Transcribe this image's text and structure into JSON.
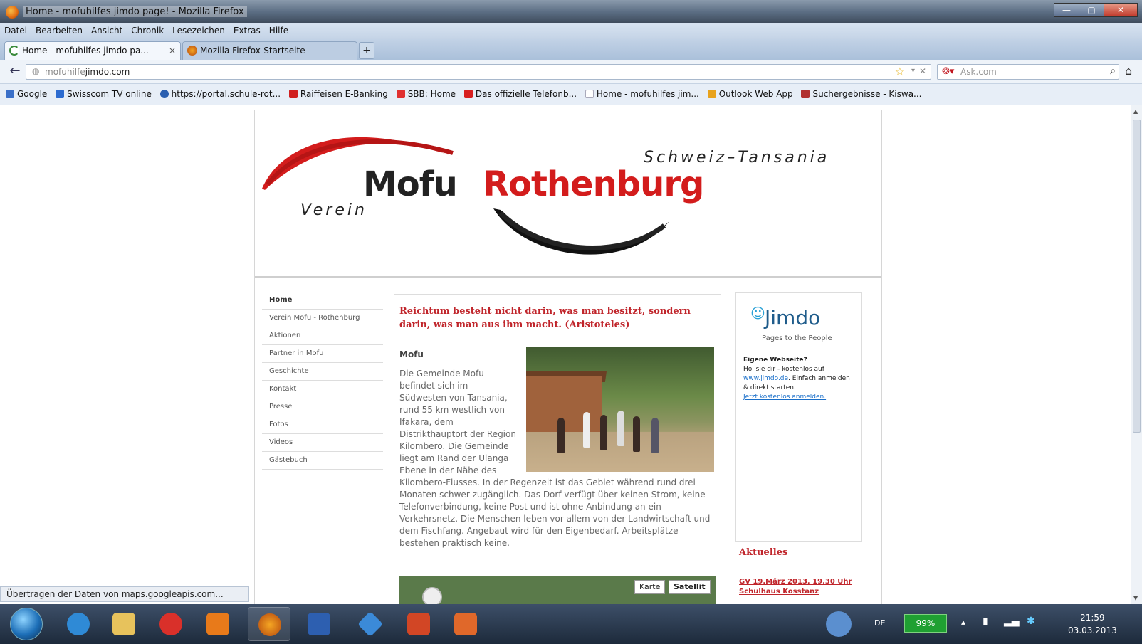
{
  "window": {
    "title": "Home - mofuhilfes jimdo page! - Mozilla Firefox",
    "controls": {
      "minimize": "—",
      "maximize": "▢",
      "close": "✕"
    }
  },
  "menu": [
    "Datei",
    "Bearbeiten",
    "Ansicht",
    "Chronik",
    "Lesezeichen",
    "Extras",
    "Hilfe"
  ],
  "tabs": [
    {
      "label": "Home - mofuhilfes jimdo pa...",
      "close": "×"
    },
    {
      "label": "Mozilla Firefox-Startseite"
    }
  ],
  "new_tab": "+",
  "nav": {
    "back": "←",
    "url_grey": "mofuhilfe",
    "url_main": "jimdo.com",
    "search_engine": "Ask",
    "search_placeholder": "Ask.com",
    "home": "⌂"
  },
  "bookmarks": [
    {
      "label": "Google",
      "color": "#3a6fc8"
    },
    {
      "label": "Swisscom TV online",
      "color": "#2c6bd0"
    },
    {
      "label": "https://portal.schule-rot...",
      "color": "#2a5fb0"
    },
    {
      "label": "Raiffeisen E-Banking",
      "color": "#d01f1f"
    },
    {
      "label": "SBB: Home",
      "color": "#e03030"
    },
    {
      "label": "Das offizielle Telefonb...",
      "color": "#d81f1f"
    },
    {
      "label": "Home - mofuhilfes jim...",
      "color": "#c9d3df"
    },
    {
      "label": "Outlook Web App",
      "color": "#e8a21c"
    },
    {
      "label": "Suchergebnisse - Kiswa...",
      "color": "#b03030"
    }
  ],
  "site": {
    "logo": {
      "verein": "Verein",
      "mofu": "Mofu",
      "rothenburg": "Rothenburg",
      "schweiz": "Schweiz–Tansania"
    },
    "nav_items": [
      "Home",
      "Verein Mofu - Rothenburg",
      "Aktionen",
      "Partner in Mofu",
      "Geschichte",
      "Kontakt",
      "Presse",
      "Fotos",
      "Videos",
      "Gästebuch"
    ],
    "quote": "Reichtum besteht nicht darin, was man besitzt, sondern darin, was man aus ihm macht. (Aristoteles)",
    "section_heading": "Mofu",
    "body_narrow": "Die Gemeinde Mofu befindet sich im Südwesten von Tansania, rund 55 km westlich von Ifakara, dem Distrikthauptort der Region Kilombero. Die Gemeinde liegt am Rand der Ulanga Ebene in der Nähe des",
    "body_wide": "Kilombero-Flusses. In der Regenzeit ist das Gebiet während rund drei Monaten schwer zugänglich. Das Dorf verfügt über keinen Strom, keine Telefonverbindung, keine Post und ist ohne Anbindung an ein Verkehrsnetz. Die Menschen leben vor allem von der Landwirtschaft und dem Fischfang. Angebaut wird für den Eigenbedarf. Arbeitsplätze bestehen praktisch keine.",
    "map_buttons": {
      "karte": "Karte",
      "satellit": "Satellit"
    },
    "sidebar": {
      "jimdo": "Jimdo",
      "jimdo_tagline": "Pages to the People",
      "heading": "Eigene Webseite?",
      "text1": "Hol sie dir - kostenlos auf",
      "link1": "www.jimdo.de",
      "text2": ". Einfach anmelden & direkt starten.",
      "link2": "Jetzt kostenlos anmelden."
    },
    "aktuelles": "Aktuelles",
    "news": "GV 19.März 2013, 19.30 Uhr Schulhaus Kosstanz"
  },
  "status_text": "Übertragen der Daten von maps.googleapis.com...",
  "taskbar": {
    "lang": "DE",
    "battery": "99%",
    "time": "21:59",
    "date": "03.03.2013"
  },
  "colors": {
    "brand_red": "#d31c1c",
    "link_blue": "#1a6fc9"
  }
}
